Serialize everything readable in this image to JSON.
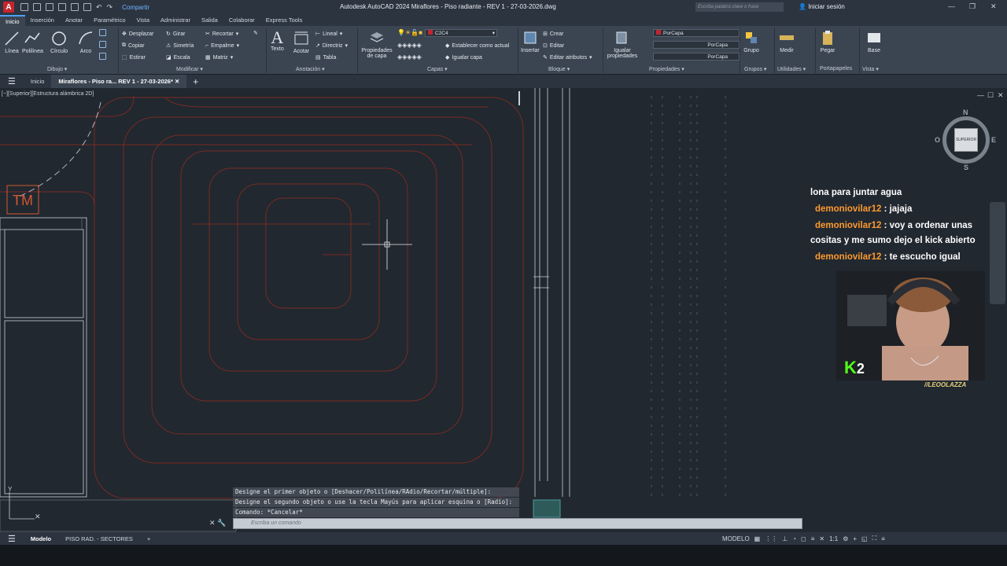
{
  "app": {
    "logo": "A",
    "title": "Autodesk AutoCAD 2024    Miraflores - Piso radiante - REV 1 - 27-03-2026.dwg",
    "share_label": "Compartir",
    "search_placeholder": "Escriba palabra clave o frase",
    "login_label": "Iniciar sesión"
  },
  "ribbon_tabs": [
    "Inicio",
    "Inserción",
    "Anotar",
    "Paramétrico",
    "Vista",
    "Administrar",
    "Salida",
    "Colaborar",
    "Express Tools"
  ],
  "ribbon": {
    "dibujo": {
      "linea": "Línea",
      "polilinea": "Polilínea",
      "circulo": "Círculo",
      "arco": "Arco",
      "title": "Dibujo ▾"
    },
    "modificar": {
      "desplazar": "Desplazar",
      "girar": "Girar",
      "recortar": "Recortar",
      "copiar": "Copiar",
      "simetria": "Simetría",
      "empalme": "Empalme",
      "estirar": "Estirar",
      "escala": "Escala",
      "matriz": "Matriz",
      "title": "Modificar ▾"
    },
    "anotacion": {
      "texto": "Texto",
      "acotar": "Acotar",
      "lineal": "Lineal",
      "directriz": "Directriz",
      "tabla": "Tabla",
      "title": "Anotación ▾"
    },
    "capas": {
      "propiedades_l1": "Propiedades",
      "propiedades_l2": "de capa",
      "layer_value": "C2C4",
      "establecer": "Establecer como actual",
      "igualar": "Igualar capa",
      "title": "Capas ▾"
    },
    "bloque": {
      "insertar": "Insertar",
      "crear": "Crear",
      "editar": "Editar",
      "editar_atributos": "Editar atributos",
      "title": "Bloque ▾"
    },
    "propiedades": {
      "igualar_l1": "Igualar",
      "igualar_l2": "propiedades",
      "color": "PorCapa",
      "tipo_linea": "PorCapa",
      "grosor": "PorCapa",
      "title": "Propiedades ▾"
    },
    "grupos": {
      "grupo": "Grupo",
      "title": "Grupos ▾"
    },
    "utilidades": {
      "medir": "Medir",
      "title": "Utilidades ▾"
    },
    "portapapeles": {
      "pegar": "Pegar",
      "title": "Portapapeles"
    },
    "vista": {
      "base": "Base",
      "title": "Vista ▾"
    }
  },
  "doc_tabs": {
    "inicio": "Inicio",
    "active": "Miraflores - Piso ra... REV 1 - 27-03-2026*"
  },
  "viewport": {
    "label": "[−][Superior][Estructura alámbrica 2D]",
    "tm_label": "TM",
    "viewcube": {
      "face": "SUPERIOR",
      "n": "N",
      "s": "S",
      "e": "E",
      "o": "O"
    },
    "wcs_label": "Y"
  },
  "chat": {
    "messages": [
      {
        "user": "",
        "text": "lona para juntar agua"
      },
      {
        "user": "demoniovilar12",
        "text": " : jajaja"
      },
      {
        "user": "demoniovilar12",
        "text": " : voy a ordenar unas cositas y me sumo dejo el kick abierto"
      },
      {
        "user": "demoniovilar12",
        "text": " : te escucho igual"
      }
    ],
    "streamer": "//LEOOLAZZA",
    "badge_k": "K",
    "badge_num": "2"
  },
  "command": {
    "history": [
      "Designe el primer objeto o [Deshacer/Polilínea/RAdio/Recortar/múltiple]:",
      "Designe el segundo objeto o use la tecla Mayús para aplicar esquina o  [Radio]:",
      "Comando: *Cancelar*"
    ],
    "placeholder": "Escriba un comando"
  },
  "status": {
    "tabs": [
      "Modelo",
      "PISO RAD. - SECTORES"
    ],
    "mode": "MODELO",
    "scale": "1:1"
  },
  "colors": {
    "accent": "#4ca0ff",
    "heating_pipe": "#7a2a22",
    "chat_user": "#ff9a2e"
  }
}
